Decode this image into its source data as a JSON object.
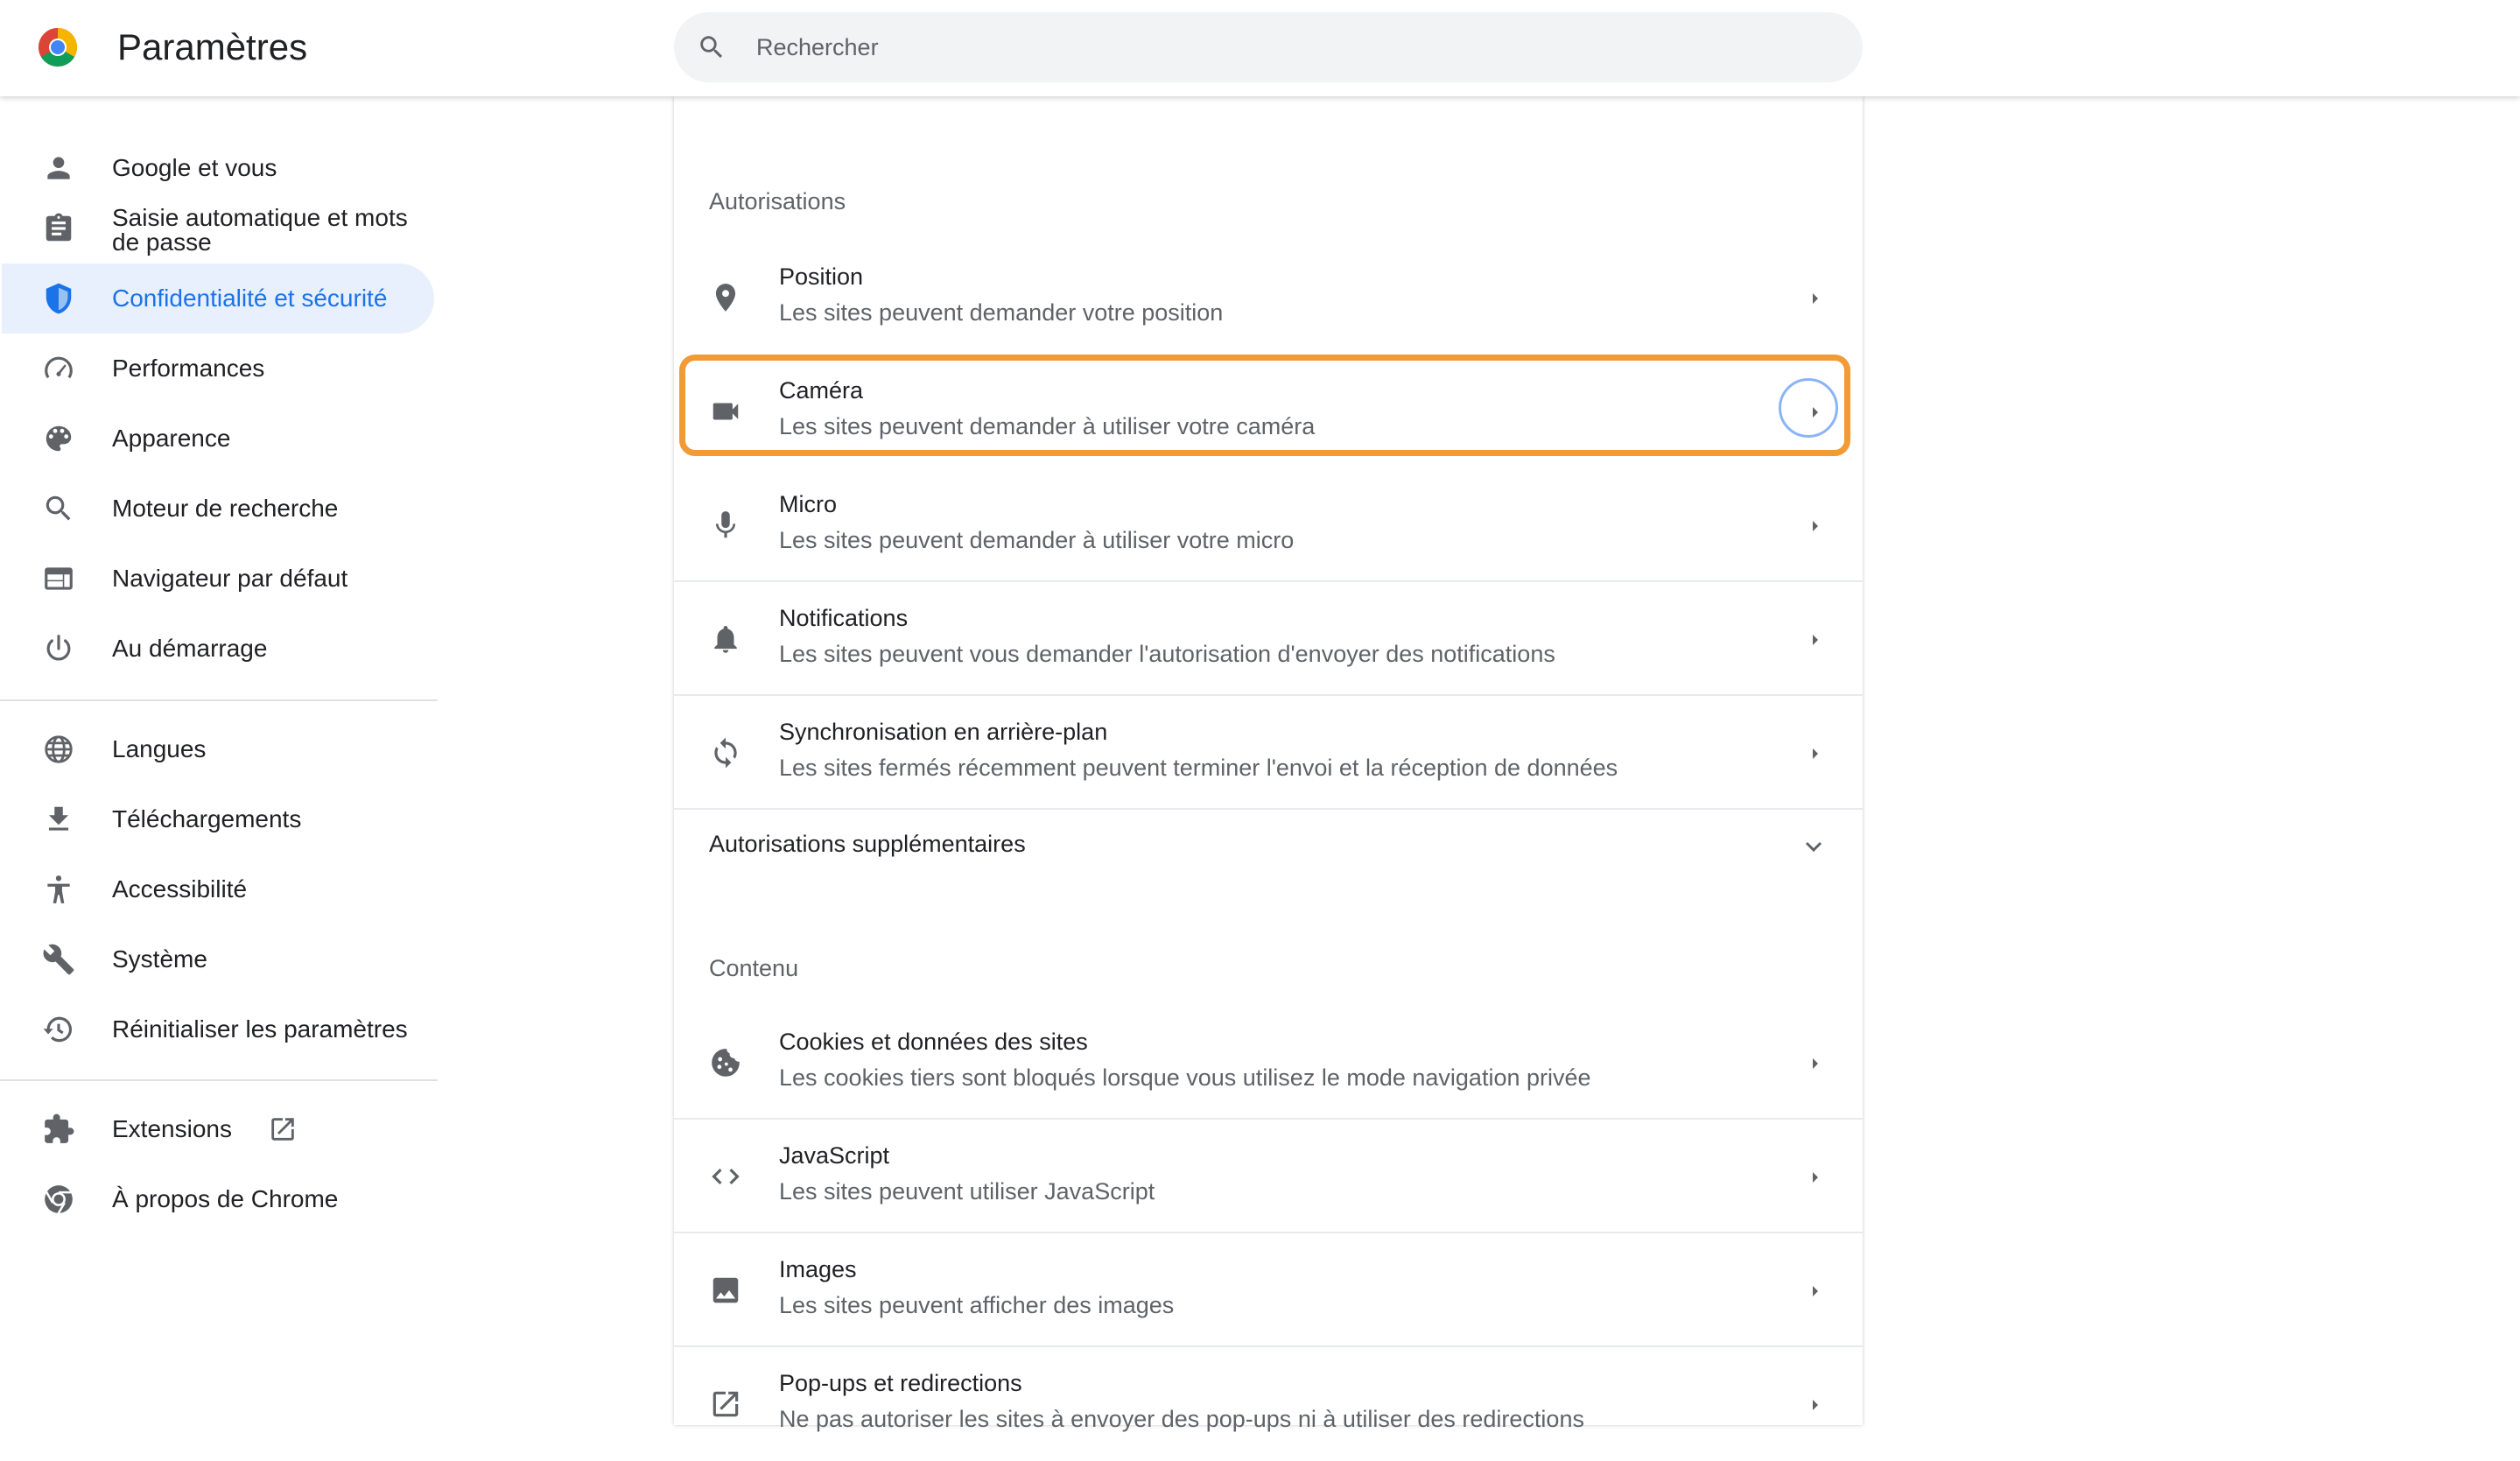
{
  "header": {
    "title": "Paramètres",
    "search_placeholder": "Rechercher"
  },
  "sidebar": {
    "items": [
      {
        "label": "Google et vous",
        "icon": "person-icon"
      },
      {
        "label": "Saisie automatique et mots de passe",
        "line1": "Saisie automatique et mots",
        "line2": "de passe",
        "icon": "clipboard-icon"
      },
      {
        "label": "Confidentialité et sécurité",
        "icon": "shield-icon",
        "active": true
      },
      {
        "label": "Performances",
        "icon": "speedometer-icon"
      },
      {
        "label": "Apparence",
        "icon": "palette-icon"
      },
      {
        "label": "Moteur de recherche",
        "icon": "search-icon"
      },
      {
        "label": "Navigateur par défaut",
        "icon": "browser-window-icon"
      },
      {
        "label": "Au démarrage",
        "icon": "power-icon"
      },
      {
        "label": "Langues",
        "icon": "globe-icon"
      },
      {
        "label": "Téléchargements",
        "icon": "download-icon"
      },
      {
        "label": "Accessibilité",
        "icon": "accessibility-icon"
      },
      {
        "label": "Système",
        "icon": "wrench-icon"
      },
      {
        "label": "Réinitialiser les paramètres",
        "icon": "restore-icon"
      },
      {
        "label": "Extensions",
        "icon": "puzzle-icon",
        "trailing_icon": "open-external-icon"
      },
      {
        "label": "À propos de Chrome",
        "icon": "chrome-icon"
      }
    ]
  },
  "main": {
    "permissions_title": "Autorisations",
    "permissions": [
      {
        "title": "Position",
        "desc": "Les sites peuvent demander votre position",
        "icon": "location-pin-icon"
      },
      {
        "title": "Caméra",
        "desc": "Les sites peuvent demander à utiliser votre caméra",
        "icon": "camera-icon",
        "highlighted": true
      },
      {
        "title": "Micro",
        "desc": "Les sites peuvent demander à utiliser votre micro",
        "icon": "microphone-icon"
      },
      {
        "title": "Notifications",
        "desc": "Les sites peuvent vous demander l'autorisation d'envoyer des notifications",
        "icon": "bell-icon"
      },
      {
        "title": "Synchronisation en arrière-plan",
        "desc": "Les sites fermés récemment peuvent terminer l'envoi et la réception de données",
        "icon": "sync-icon"
      }
    ],
    "additional_permissions": "Autorisations supplémentaires",
    "content_title": "Contenu",
    "content": [
      {
        "title": "Cookies et données des sites",
        "desc": "Les cookies tiers sont bloqués lorsque vous utilisez le mode navigation privée",
        "icon": "cookie-icon"
      },
      {
        "title": "JavaScript",
        "desc": "Les sites peuvent utiliser JavaScript",
        "icon": "code-icon"
      },
      {
        "title": "Images",
        "desc": "Les sites peuvent afficher des images",
        "icon": "image-icon"
      },
      {
        "title": "Pop-ups et redirections",
        "desc": "Ne pas autoriser les sites à envoyer des pop-ups ni à utiliser des redirections",
        "icon": "popup-icon"
      }
    ]
  },
  "colors": {
    "accent": "#1a73e8",
    "active_bg": "#e8f0fe",
    "highlight": "#f29a36",
    "icon": "#5f6368"
  }
}
